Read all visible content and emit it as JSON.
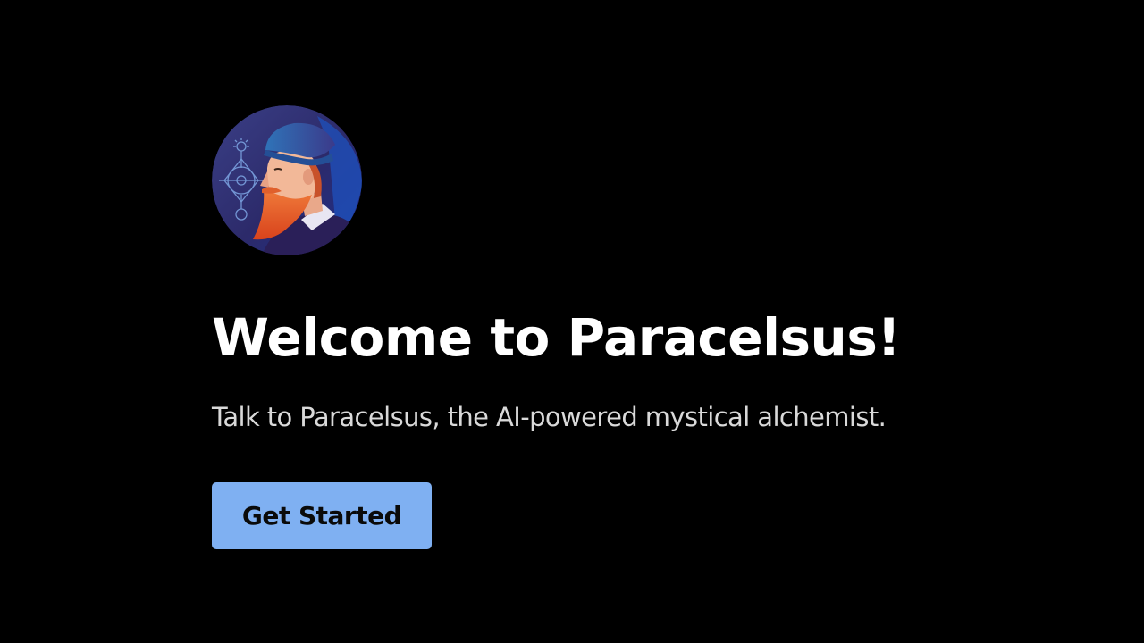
{
  "welcome": {
    "title": "Welcome to Paracelsus!",
    "subtitle": "Talk to Paracelsus, the AI-powered mystical alchemist.",
    "cta_label": "Get Started"
  },
  "avatar": {
    "icon": "alchemist-portrait-icon"
  },
  "colors": {
    "background": "#000000",
    "title": "#ffffff",
    "subtitle": "#d9d9d9",
    "button_bg": "#7fb0f2",
    "button_text": "#0a0a0a"
  }
}
